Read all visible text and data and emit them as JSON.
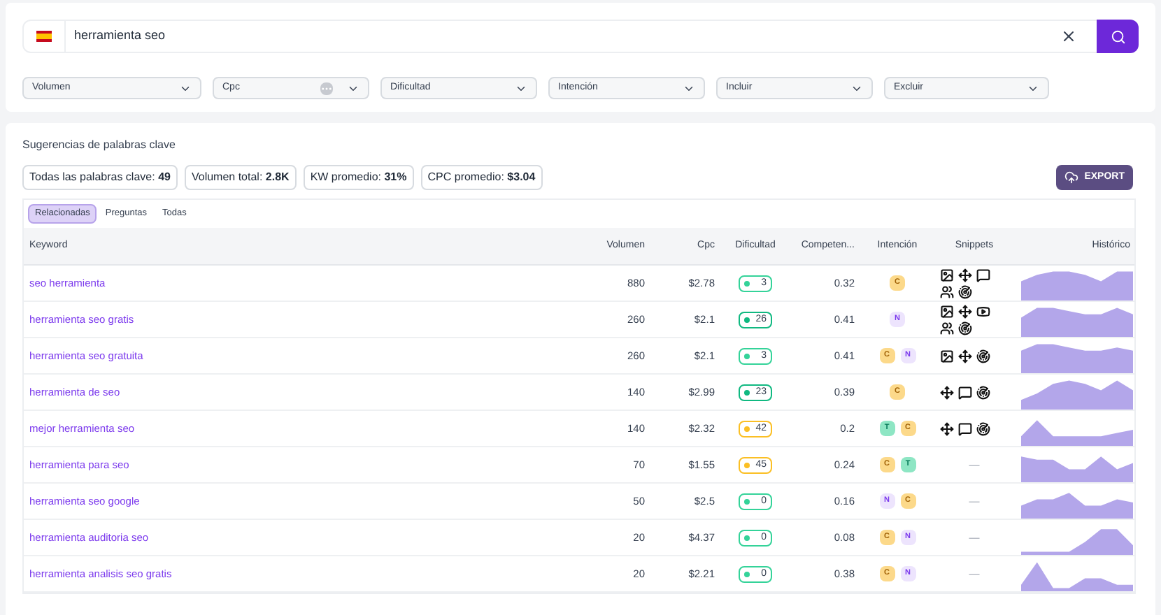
{
  "search": {
    "value": "herramienta seo"
  },
  "filters": [
    {
      "label": "Volumen",
      "kind": "dropdown"
    },
    {
      "label": "Cpc",
      "kind": "currency"
    },
    {
      "label": "Dificultad",
      "kind": "dropdown"
    },
    {
      "label": "Intención",
      "kind": "dropdown"
    },
    {
      "label": "Incluir",
      "kind": "dropdown"
    },
    {
      "label": "Excluir",
      "kind": "dropdown"
    }
  ],
  "section_title": "Sugerencias de palabras clave",
  "stats": [
    {
      "label": "Todas las palabras clave:",
      "value": "49"
    },
    {
      "label": "Volumen total:",
      "value": "2.8K"
    },
    {
      "label": "KW promedio:",
      "value": "31%"
    },
    {
      "label": "CPC promedio:",
      "value": "$3.04"
    }
  ],
  "export_button": "EXPORT",
  "tabs": [
    {
      "label": "Relacionadas",
      "selected": true
    },
    {
      "label": "Preguntas",
      "selected": false
    },
    {
      "label": "Todas",
      "selected": false
    }
  ],
  "table": {
    "columns": [
      "Keyword",
      "Volumen",
      "Cpc",
      "Dificultad",
      "Competen...",
      "Intención",
      "Snippets",
      "Histórico"
    ],
    "rows": [
      {
        "keyword": "seo herramienta",
        "volume": "880",
        "cpc": "$2.78",
        "difficulty": {
          "value": "3",
          "color": "#34d399"
        },
        "competition": "0.32",
        "intent": [
          {
            "label": "C",
            "kind": "commercial"
          }
        ],
        "snippets": [
          {
            "kind": "image"
          },
          {
            "kind": "pack"
          },
          {
            "kind": "forum"
          },
          {
            "kind": "people"
          },
          {
            "kind": "radar"
          }
        ]
      },
      {
        "keyword": "herramienta seo gratis",
        "volume": "260",
        "cpc": "$2.1",
        "difficulty": {
          "value": "26",
          "color": "#10b981"
        },
        "competition": "0.41",
        "intent": [
          {
            "label": "N",
            "kind": "navigational"
          }
        ],
        "snippets": [
          {
            "kind": "image"
          },
          {
            "kind": "pack"
          },
          {
            "kind": "video"
          },
          {
            "kind": "people"
          },
          {
            "kind": "radar"
          }
        ]
      },
      {
        "keyword": "herramienta seo gratuita",
        "volume": "260",
        "cpc": "$2.1",
        "difficulty": {
          "value": "3",
          "color": "#34d399"
        },
        "competition": "0.41",
        "intent": [
          {
            "label": "C",
            "kind": "commercial"
          },
          {
            "label": "N",
            "kind": "navigational"
          }
        ],
        "snippets": [
          {
            "kind": "image"
          },
          {
            "kind": "pack"
          },
          {
            "kind": "radar"
          }
        ]
      },
      {
        "keyword": "herramienta de seo",
        "volume": "140",
        "cpc": "$2.99",
        "difficulty": {
          "value": "23",
          "color": "#10b981"
        },
        "competition": "0.39",
        "intent": [
          {
            "label": "C",
            "kind": "commercial"
          }
        ],
        "snippets": [
          {
            "kind": "pack"
          },
          {
            "kind": "forum"
          },
          {
            "kind": "radar"
          }
        ]
      },
      {
        "keyword": "mejor herramienta seo",
        "volume": "140",
        "cpc": "$2.32",
        "difficulty": {
          "value": "42",
          "color": "#fbbf24"
        },
        "competition": "0.2",
        "intent": [
          {
            "label": "T",
            "kind": "transactional"
          },
          {
            "label": "C",
            "kind": "commercial"
          }
        ],
        "snippets": [
          {
            "kind": "pack"
          },
          {
            "kind": "forum"
          },
          {
            "kind": "radar"
          }
        ]
      },
      {
        "keyword": "herramienta para seo",
        "volume": "70",
        "cpc": "$1.55",
        "difficulty": {
          "value": "45",
          "color": "#fbbf24"
        },
        "competition": "0.24",
        "intent": [
          {
            "label": "C",
            "kind": "commercial"
          },
          {
            "label": "T",
            "kind": "transactional"
          }
        ],
        "no_snippets": "—"
      },
      {
        "keyword": "herramienta seo google",
        "volume": "50",
        "cpc": "$2.5",
        "difficulty": {
          "value": "0",
          "color": "#34d399"
        },
        "competition": "0.16",
        "intent": [
          {
            "label": "N",
            "kind": "navigational"
          },
          {
            "label": "C",
            "kind": "commercial"
          }
        ],
        "no_snippets": "—"
      },
      {
        "keyword": "herramienta auditoria seo",
        "volume": "20",
        "cpc": "$4.37",
        "difficulty": {
          "value": "0",
          "color": "#34d399"
        },
        "competition": "0.08",
        "intent": [
          {
            "label": "C",
            "kind": "commercial"
          },
          {
            "label": "N",
            "kind": "navigational"
          }
        ],
        "no_snippets": "—"
      },
      {
        "keyword": "herramienta analisis seo gratis",
        "volume": "20",
        "cpc": "$2.21",
        "difficulty": {
          "value": "0",
          "color": "#34d399"
        },
        "competition": "0.38",
        "intent": [
          {
            "label": "C",
            "kind": "commercial"
          },
          {
            "label": "N",
            "kind": "navigational"
          }
        ],
        "no_snippets": "—"
      }
    ]
  }
}
